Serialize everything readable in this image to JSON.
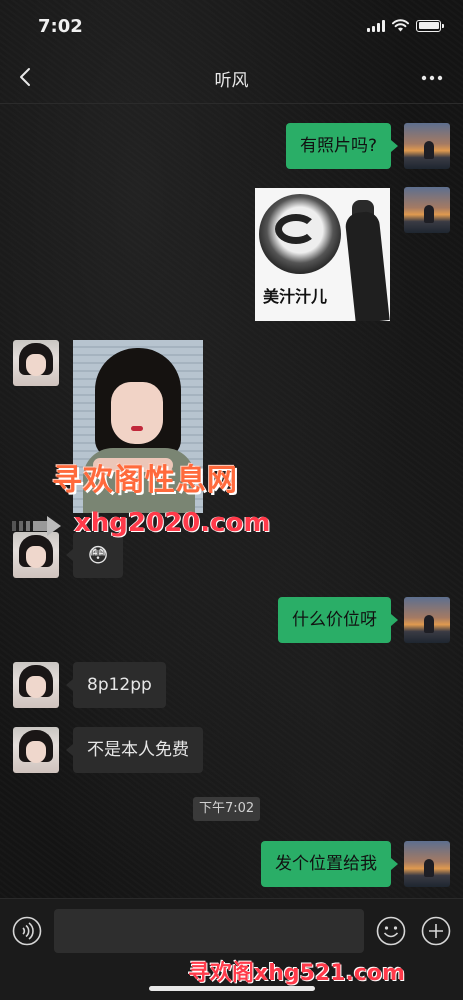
{
  "status_bar": {
    "time": "7:02"
  },
  "nav": {
    "title": "听风"
  },
  "messages": [
    {
      "side": "right",
      "type": "text",
      "text": "有照片吗?"
    },
    {
      "side": "right",
      "type": "sticker",
      "caption": "美汁汁儿"
    },
    {
      "side": "left",
      "type": "photo"
    },
    {
      "side": "left",
      "type": "emoji",
      "emoji": "😳"
    },
    {
      "side": "right",
      "type": "text",
      "text": "什么价位呀"
    },
    {
      "side": "left",
      "type": "text",
      "text": "8p12pp"
    },
    {
      "side": "left",
      "type": "text",
      "text": "不是本人免费"
    },
    {
      "side": "right",
      "type": "text",
      "text": "发个位置给我"
    }
  ],
  "time_divider": "下午7:02",
  "watermarks": {
    "line1": "寻欢阁性息网",
    "line2": "xhg2020.com",
    "bottom": "寻欢阁xhg521.com"
  },
  "colors": {
    "outgoing_bubble": "#2aae67",
    "incoming_bubble": "#2c2c2c",
    "background": "#141414"
  },
  "icons": {
    "back": "chevron-left-icon",
    "more": "more-dots-icon",
    "voice": "voice-icon",
    "emoji": "emoji-icon",
    "plus": "plus-icon"
  }
}
